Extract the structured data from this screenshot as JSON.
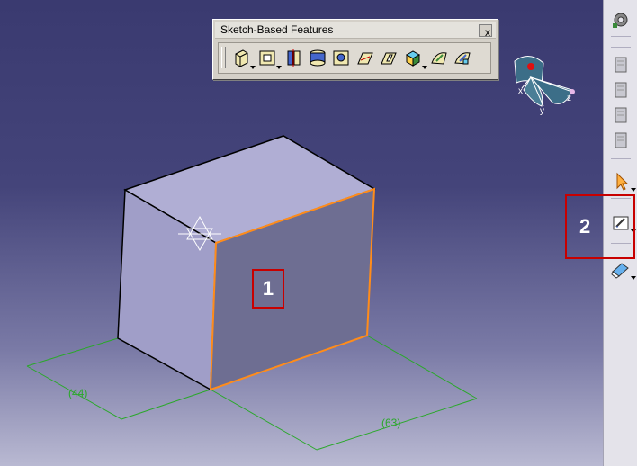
{
  "toolbar": {
    "title": "Sketch-Based Features",
    "close_glyph": "x",
    "buttons": [
      "pad-icon",
      "pocket-icon",
      "shaft-icon",
      "groove-icon",
      "hole-icon",
      "rib-icon",
      "slot-icon",
      "solid-combine-icon",
      "multi-sections-solid-icon",
      "remove-multi-sections-icon"
    ]
  },
  "dimensions": {
    "left": "(44)",
    "right": "(63)"
  },
  "compass_axes": {
    "x": "x",
    "y": "y",
    "z": "z"
  },
  "callouts": {
    "one": "1",
    "two": "2"
  },
  "sidebar": {
    "items": [
      "gear-icon",
      "document-icon-1",
      "document-icon-2",
      "document-icon-3",
      "document-icon-4",
      "select-arrow-icon",
      "sketcher-icon",
      "eraser-icon"
    ]
  },
  "colors": {
    "selection": "#ff8c1a",
    "dimension": "#2aa82a",
    "callout": "#c80000"
  }
}
